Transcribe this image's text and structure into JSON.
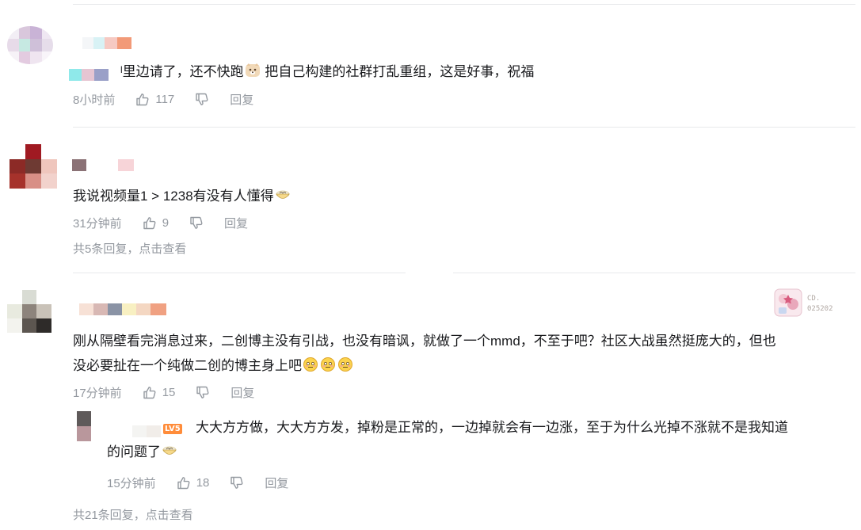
{
  "colors": {
    "text": "#18191c",
    "meta": "#9499a0",
    "divider": "#e8e9eb",
    "level_badge": "#ff8c3a"
  },
  "comments": [
    {
      "content_prefix": "ˡ里边请了，还不快跑",
      "content_emoji": "doge-emoji",
      "content_suffix": " 把自己构建的社群打乱重组，这是好事，祝福",
      "time": "8小时前",
      "likes": "117",
      "reply_label": "回复"
    },
    {
      "content": "我说视频量1 > 1238有没有人懂得",
      "content_emoji": "bowl-emoji",
      "time": "31分钟前",
      "likes": "9",
      "reply_label": "回复",
      "more_replies": "共5条回复，点击查看"
    },
    {
      "content_line1": "刚从隔壁看完消息过来，二创博主没有引战，也没有暗讽，就做了一个mmd，不至于吧？社区大战虽然挺庞大的，但也",
      "content_line2": "没必要扯在一个纯做二创的博主身上吧",
      "content_emojis": [
        "awkward-emoji",
        "awkward-emoji",
        "awkward-emoji"
      ],
      "time": "17分钟前",
      "likes": "15",
      "reply_label": "回复",
      "badge_text_1": "CD.",
      "badge_text_2": "025202",
      "more_replies": "共21条回复，点击查看",
      "sub_reply": {
        "level_badge": "LV5",
        "content_line1": "大大方方做，大大方方发，掉粉是正常的，一边掉就会有一边涨，至于为什么光掉不涨就不是我知道",
        "content_line2": "的问题了",
        "content_emoji": "bowl-emoji",
        "time": "15分钟前",
        "likes": "18",
        "reply_label": "回复"
      }
    }
  ]
}
